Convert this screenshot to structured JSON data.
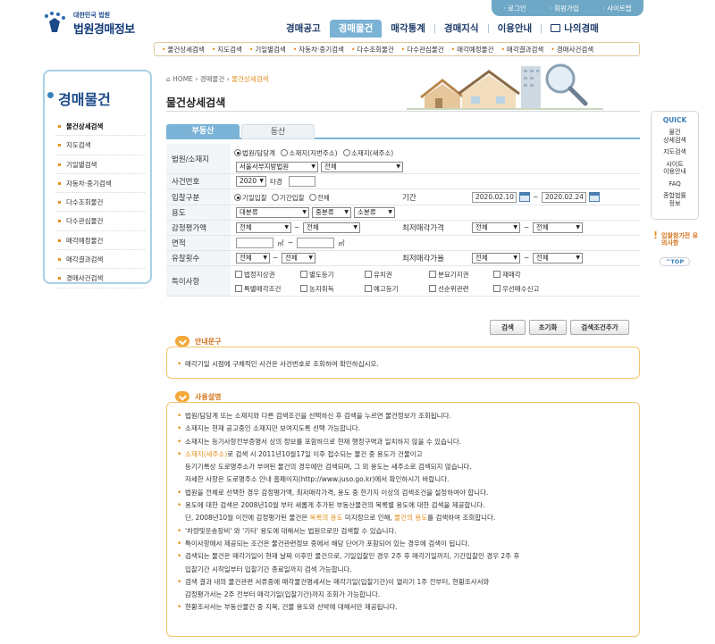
{
  "header": {
    "logo_small": "대한민국 법원",
    "logo_big": "법원경매정보",
    "util": [
      "· 로그인",
      "· 회원가입",
      "· 사이트맵"
    ],
    "gnb": [
      "경매공고",
      "경매물건",
      "매각통계",
      "경매지식",
      "이용안내",
      "나의경매"
    ],
    "lnb": [
      "물건상세검색",
      "지도검색",
      "기일별검색",
      "자동차·중기검색",
      "다수조회물건",
      "다수관심물건",
      "매각예정물건",
      "매각결과검색",
      "경매사건검색"
    ]
  },
  "left": {
    "title": "경매물건",
    "menu": [
      "물건상세검색",
      "지도검색",
      "기일별검색",
      "자동차·중기검색",
      "다수조회물건",
      "다수관심물건",
      "매각예정물건",
      "매각결과검색",
      "경매사건검색"
    ]
  },
  "crumb": {
    "home": "HOME",
    "level1": "경매물건",
    "level2": "물건상세검색"
  },
  "page_title": "물건상세검색",
  "tabs": [
    "부동산",
    "동산"
  ],
  "form": {
    "court_label": "법원/소재지",
    "court_radio1": "법원/담당계",
    "court_radio2": "소재지(지번주소)",
    "court_radio3": "소재지(새주소)",
    "court_select": "서울서부지방법원",
    "dept_select": "전체",
    "case_label": "사건번호",
    "case_year": "2020",
    "case_type": "타경",
    "bid_label": "입찰구분",
    "bid_radio1": "기일입찰",
    "bid_radio2": "기간입찰",
    "bid_radio3": "전체",
    "period_label": "기간",
    "date_from": "2020.02.10",
    "date_to": "2020.02.24",
    "tilde": "~",
    "use_label": "용도",
    "use1": "대분류",
    "use2": "중분류",
    "use3": "소분류",
    "appraise_label": "감정평가액",
    "appraise_from": "전체",
    "appraise_to": "전체",
    "minprice_label": "최저매각가격",
    "minprice_from": "전체",
    "minprice_to": "전체",
    "area_label": "면적",
    "area_unit": "㎡",
    "fail_label": "유찰횟수",
    "fail_from": "전체",
    "fail_to": "전체",
    "rate_label": "최저매각가율",
    "rate_from": "전체",
    "rate_to": "전체",
    "special_label": "특이사항",
    "special": [
      "법정지상권",
      "별도등기",
      "유치권",
      "분묘기지권",
      "재매각",
      "특별매각조건",
      "농지취득",
      "예고등기",
      "선순위관련",
      "우선매수신고"
    ]
  },
  "buttons": {
    "search": "검색",
    "reset": "초기화",
    "add": "검색조건추가"
  },
  "notice1": {
    "title": "안내문구",
    "text": "매각기일 시점에 구체적인 사건은 사건번호로 조회하여 확인하십시오."
  },
  "notice2": {
    "title": "사용설명",
    "lines": [
      "법원/담당계 또는 소재지와 다른 검색조건을 선택하신 후 검색을 누르면 물건정보가 조회됩니다.",
      "소재지는 현재 공고중인 소재지만 보여지도록 선택 가능합니다.",
      "소재지는 등기사항전부증명서 상의 정보를 포함하므로 현재 행정구역과 일치하지 않을 수 있습니다.",
      "소재지(새주소)로 검색 시 2011년10월17일 이후 접수되는 물건 중 용도가 건물이고",
      "등기기록상 도로명주소가 부여된 물건의 경우에만 검색되며, 그 외 용도는 새주소로 검색되지 않습니다.",
      "자세한 사항은 도로명주소 안내 홈페이지(http://www.juso.go.kr)에서 확인하시기 바랍니다.",
      "법원을 전체로 선택한 경우 감정평가액, 최저매각가격, 용도 중 한가지 이상의 검색조건을 설정하여야 합니다.",
      "용도에 대한 검색은 2008년10월 부터 새롭게 추가된 부동산물건의 목록별 용도에 대한 검색을 제공합니다.",
      "단, 2008년10월 이전에 감정평가된 물건은 목록의 용도 미지정으로 인해, 물건의 용도를 검색하여 조회합니다.",
      "'차량및운송장비' 와 '기타' 용도에 대해서는 법원으로만 검색할 수 있습니다.",
      "특이사항에서 제공되는 조건은 물건관련정보 중에서 해당 단어가 포함되어 있는 경우에 검색이 됩니다.",
      "검색되는 물건은 매각기일이 현재 날짜 이후인 물건으로, 기일입찰인 경우 2주 후 매각기일까지, 기간입찰인 경우 2주 후",
      "입찰기간 시작일부터 입찰기간 종료일까지 검색 가능합니다.",
      "검색 결과 내의 물건관련 서류중에 매각물건명세서는 매각기일(입찰기간)이 열리기 1주 전부터, 현황조사서와",
      "감정평가서는 2주 전부터 매각기일(입찰기간)까지 조회가 가능합니다.",
      "현황조사서는 부동산물건 중 지목, 건물 용도와 선박에 대해서만 제공됩니다."
    ]
  },
  "quick": {
    "title": "QUICK",
    "items": [
      "물건\n상세검색",
      "지도검색",
      "사이트\n이용안내",
      "FAQ",
      "종합법률\n정보"
    ],
    "alert": "입찰참가전 유의사항",
    "top": "TOP"
  },
  "colors": {
    "accent": "#7bb3d6",
    "orange": "#e38f1c",
    "navy": "#1c3a6a"
  }
}
